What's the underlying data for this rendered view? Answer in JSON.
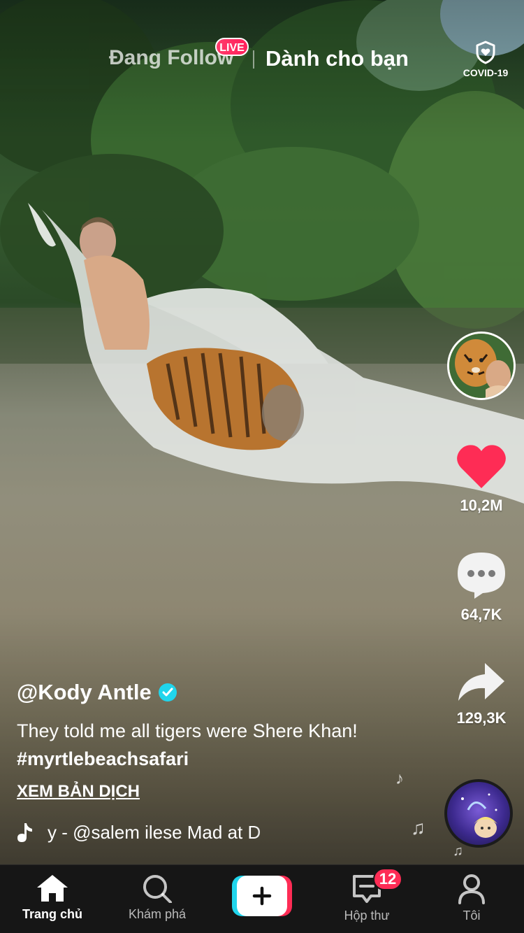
{
  "top_tabs": {
    "following_label": "Đang Follow",
    "live_badge": "LIVE",
    "for_you_label": "Dành cho bạn",
    "covid_label": "COVID-19"
  },
  "actions": {
    "likes": "10,2M",
    "comments": "64,7K",
    "shares": "129,3K",
    "like_color": "#fe2c55"
  },
  "post": {
    "username": "@Kody Antle",
    "description": "They told me all tigers were Shere Khan!",
    "hashtag": "#myrtlebeachsafari",
    "translate_label": "XEM BẢN DỊCH",
    "music": "y - @salem ilese    Mad at D"
  },
  "nav": {
    "home_label": "Trang chủ",
    "explore_label": "Khám phá",
    "inbox_label": "Hộp thư",
    "inbox_badge": "12",
    "me_label": "Tôi"
  },
  "colors": {
    "accent_red": "#fe2c55",
    "accent_cyan": "#20d5ec",
    "nav_bg": "#161616"
  }
}
